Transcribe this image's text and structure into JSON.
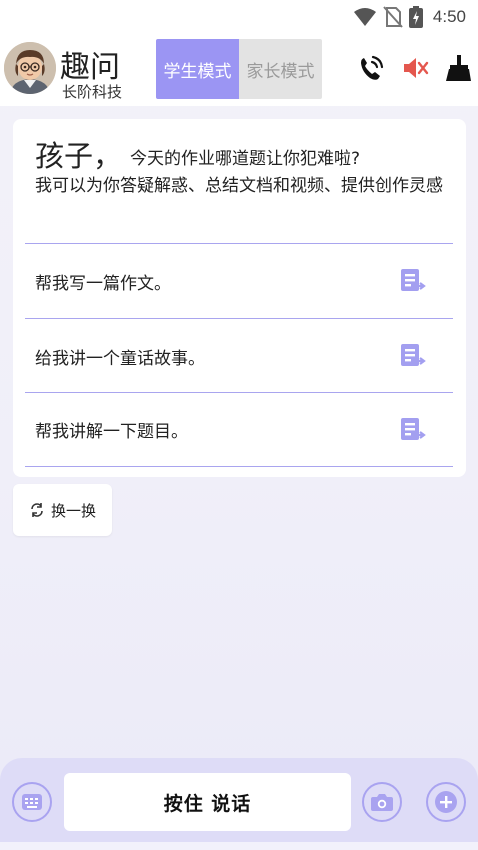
{
  "status_bar": {
    "time": "4:50",
    "icons": [
      "wifi-icon",
      "no-sim-icon",
      "battery-charging-icon"
    ]
  },
  "header": {
    "app_name": "趣问",
    "company": "长阶科技",
    "modes": [
      "学生模式",
      "家长模式"
    ],
    "active_mode": "学生模式",
    "icons": [
      "phone-ring-icon",
      "mute-icon",
      "broom-icon"
    ],
    "accent_color": "#9b95f3"
  },
  "welcome": {
    "greeting": "孩子，",
    "question": "今天的作业哪道题让你犯难啦?",
    "intro": "我可以为你答疑解惑、总结文档和视频、提供创作灵感"
  },
  "suggestions": [
    {
      "text": "帮我写一篇作文。"
    },
    {
      "text": "给我讲一个童话故事。"
    },
    {
      "text": "帮我讲解一下题目。"
    }
  ],
  "refresh": {
    "label": "换一换"
  },
  "bottom_bar": {
    "talk_label": "按住 说话",
    "icons": [
      "keyboard-icon",
      "camera-icon",
      "plus-icon"
    ]
  }
}
